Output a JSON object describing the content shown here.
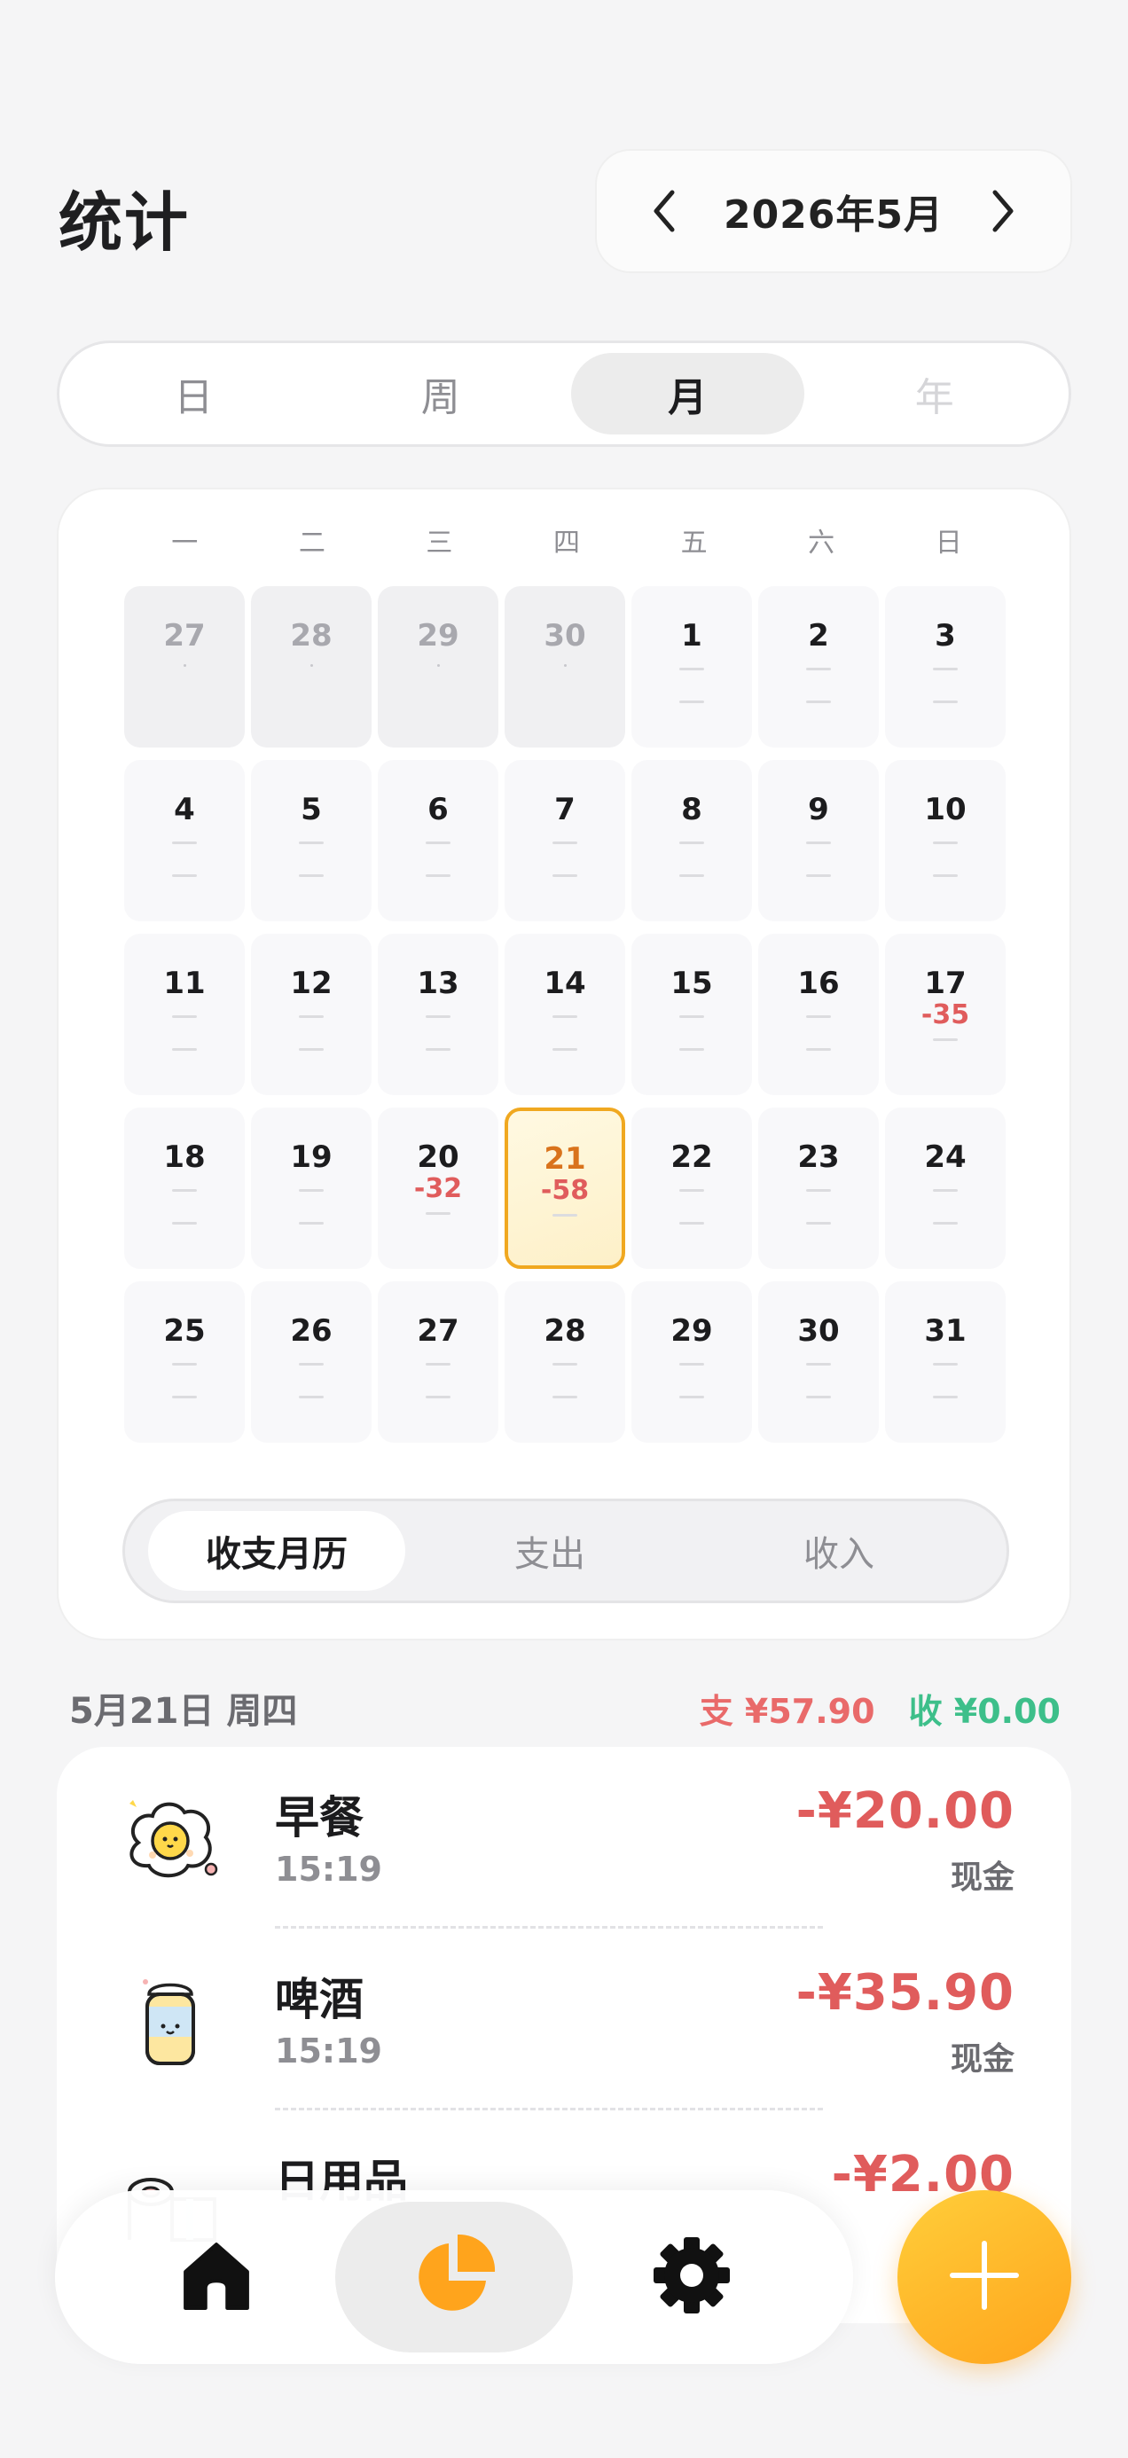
{
  "header": {
    "title": "统计",
    "month_label": "2026年5月"
  },
  "period_tabs": [
    {
      "label": "日",
      "state": "normal"
    },
    {
      "label": "周",
      "state": "normal"
    },
    {
      "label": "月",
      "state": "active"
    },
    {
      "label": "年",
      "state": "disabled"
    }
  ],
  "calendar": {
    "weekdays": [
      "一",
      "二",
      "三",
      "四",
      "五",
      "六",
      "日"
    ],
    "days": [
      {
        "num": "27",
        "out": true
      },
      {
        "num": "28",
        "out": true
      },
      {
        "num": "29",
        "out": true
      },
      {
        "num": "30",
        "out": true
      },
      {
        "num": "1"
      },
      {
        "num": "2"
      },
      {
        "num": "3"
      },
      {
        "num": "4"
      },
      {
        "num": "5"
      },
      {
        "num": "6"
      },
      {
        "num": "7"
      },
      {
        "num": "8"
      },
      {
        "num": "9"
      },
      {
        "num": "10"
      },
      {
        "num": "11"
      },
      {
        "num": "12"
      },
      {
        "num": "13"
      },
      {
        "num": "14"
      },
      {
        "num": "15"
      },
      {
        "num": "16"
      },
      {
        "num": "17",
        "expense": "-35"
      },
      {
        "num": "18"
      },
      {
        "num": "19"
      },
      {
        "num": "20",
        "expense": "-32"
      },
      {
        "num": "21",
        "expense": "-58",
        "selected": true
      },
      {
        "num": "22"
      },
      {
        "num": "23"
      },
      {
        "num": "24"
      },
      {
        "num": "25"
      },
      {
        "num": "26"
      },
      {
        "num": "27"
      },
      {
        "num": "28"
      },
      {
        "num": "29"
      },
      {
        "num": "30"
      },
      {
        "num": "31"
      }
    ]
  },
  "view_tabs": [
    {
      "label": "收支月历",
      "active": true
    },
    {
      "label": "支出",
      "active": false
    },
    {
      "label": "收入",
      "active": false
    }
  ],
  "day_summary": {
    "date": "5月21日 周四",
    "expense": "支 ¥57.90",
    "income": "收 ¥0.00"
  },
  "transactions": [
    {
      "icon": "fried-egg-icon",
      "name": "早餐",
      "time": "15:19",
      "amount": "-¥20.00",
      "method": "现金"
    },
    {
      "icon": "beer-can-icon",
      "name": "啤酒",
      "time": "15:19",
      "amount": "-¥35.90",
      "method": "现金"
    },
    {
      "icon": "toilet-paper-icon",
      "name": "日用品",
      "time": "",
      "amount": "-¥2.00",
      "method": ""
    }
  ],
  "nav": [
    {
      "icon": "home-icon",
      "active": false
    },
    {
      "icon": "pie-chart-icon",
      "active": true
    },
    {
      "icon": "gear-icon",
      "active": false
    }
  ],
  "colors": {
    "expense": "#e05c5c",
    "income": "#3dbf8a",
    "accent": "#ffa41c",
    "selected_border": "#f0a820"
  }
}
